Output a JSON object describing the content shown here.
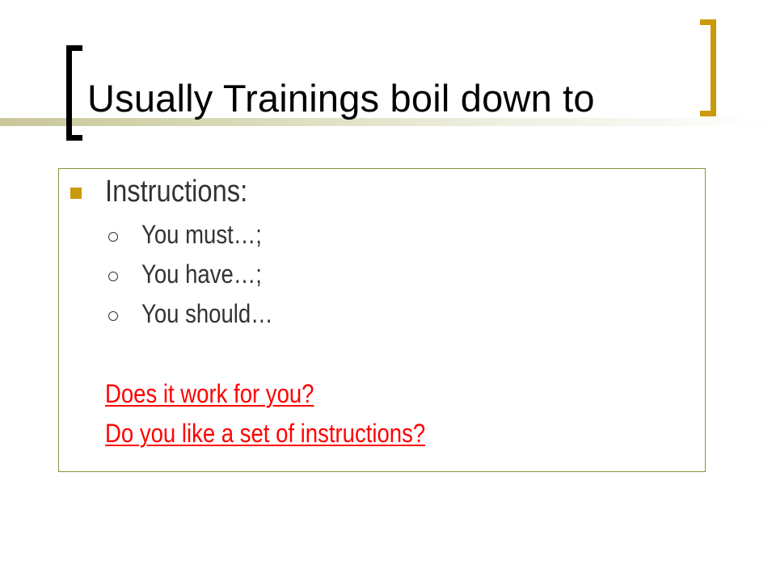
{
  "slide": {
    "title": "Usually Trainings boil down to",
    "bullet": {
      "label": "Instructions:",
      "items": [
        {
          "label": "You must…;"
        },
        {
          "label": "You have…;"
        },
        {
          "label": "You should…"
        }
      ]
    },
    "links": [
      {
        "label": "Does it work for you?"
      },
      {
        "label": "Do you like a set of instructions?"
      }
    ]
  },
  "colors": {
    "accent": "#c99a0a",
    "link": "#ff0000",
    "body_text": "#333333",
    "box_border": "#8f8f3f"
  }
}
